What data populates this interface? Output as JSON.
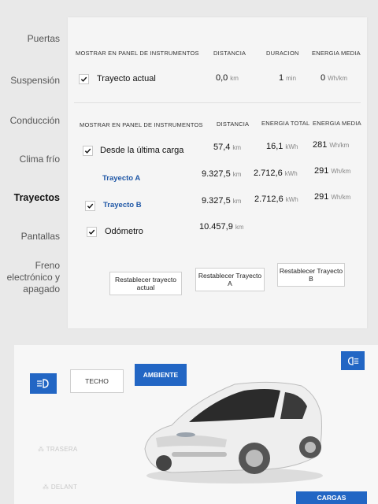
{
  "sidebar": {
    "items": [
      {
        "label": "Puertas"
      },
      {
        "label": "Suspensión"
      },
      {
        "label": "Conducción"
      },
      {
        "label": "Clima frío"
      },
      {
        "label": "Trayectos"
      },
      {
        "label": "Pantallas"
      },
      {
        "label": "Freno electrónico y apagado"
      }
    ]
  },
  "section1": {
    "headers": {
      "show": "MOSTRAR EN PANEL DE INSTRUMENTOS",
      "distance": "DISTANCIA",
      "duration": "DURACION",
      "avg_energy": "ENERGIA MEDIA"
    },
    "row": {
      "label": "Trayecto actual",
      "checked": true,
      "distance": "0,0",
      "distance_unit": "km",
      "duration": "1",
      "duration_unit": "min",
      "energy": "0",
      "energy_unit": "Wh/km"
    }
  },
  "section2": {
    "headers": {
      "show": "MOSTRAR EN PANEL DE INSTRUMENTOS",
      "distance": "DISTANCIA",
      "total_energy": "ENERGIA TOTAL",
      "avg_energy": "ENERGIA MEDIA"
    },
    "rows": [
      {
        "label": "Desde la última carga",
        "checked": true,
        "distance": "57,4",
        "distance_unit": "km",
        "total": "16,1",
        "total_unit": "kWh",
        "avg": "281",
        "avg_unit": "Wh/km"
      },
      {
        "label": "Trayecto A",
        "checked": false,
        "distance": "9.327,5",
        "distance_unit": "km",
        "total": "2.712,6",
        "total_unit": "kWh",
        "avg": "291",
        "avg_unit": "Wh/km"
      },
      {
        "label": "Trayecto B",
        "checked": true,
        "distance": "9.327,5",
        "distance_unit": "km",
        "total": "2.712,6",
        "total_unit": "kWh",
        "avg": "291",
        "avg_unit": "Wh/km"
      },
      {
        "label": "Odómetro",
        "checked": true,
        "distance": "10.457,9",
        "distance_unit": "km"
      }
    ],
    "buttons": {
      "reset_current": "Restablecer trayecto actual",
      "reset_a": "Restablecer Trayecto A",
      "reset_b": "Restablecer Trayecto B"
    }
  },
  "lower": {
    "techo": "TECHO",
    "ambiente": "AMBIENTE",
    "trasera": "TRASERA",
    "delant": "DELANT",
    "cargas": "CARGAS",
    "accent": "#2266c4"
  }
}
